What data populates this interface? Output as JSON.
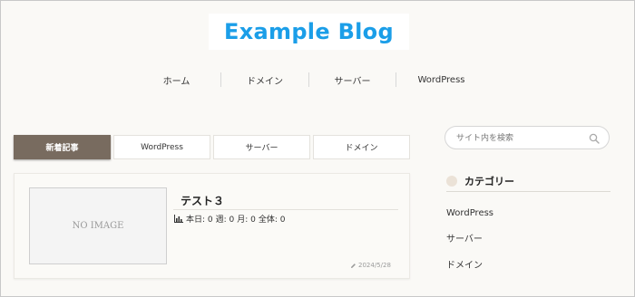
{
  "header": {
    "logo": "Example Blog"
  },
  "global_nav": {
    "items": [
      {
        "label": "ホーム"
      },
      {
        "label": "ドメイン"
      },
      {
        "label": "サーバー"
      },
      {
        "label": "WordPress"
      }
    ]
  },
  "tabs": {
    "items": [
      {
        "label": "新着記事",
        "active": true
      },
      {
        "label": "WordPress",
        "active": false
      },
      {
        "label": "サーバー",
        "active": false
      },
      {
        "label": "ドメイン",
        "active": false
      }
    ]
  },
  "article": {
    "thumbnail_text": "NO IMAGE",
    "title": "テスト３",
    "stats": {
      "icon": "bar-chart-icon",
      "today": "本日: 0",
      "week": "週: 0",
      "month": "月: 0",
      "total": "全体: 0"
    },
    "date": "2024/5/28",
    "date_icon": "pencil-icon"
  },
  "sidebar": {
    "search": {
      "placeholder": "サイト内を検索",
      "value": "",
      "icon": "search-icon"
    },
    "categories": {
      "title": "カテゴリー",
      "items": [
        {
          "label": "WordPress"
        },
        {
          "label": "サーバー"
        },
        {
          "label": "ドメイン"
        }
      ]
    }
  },
  "colors": {
    "accent": "#1b9ee8",
    "active_tab": "#786b5f",
    "background": "#faf9f6",
    "heading_dot": "#ebe2d7"
  }
}
